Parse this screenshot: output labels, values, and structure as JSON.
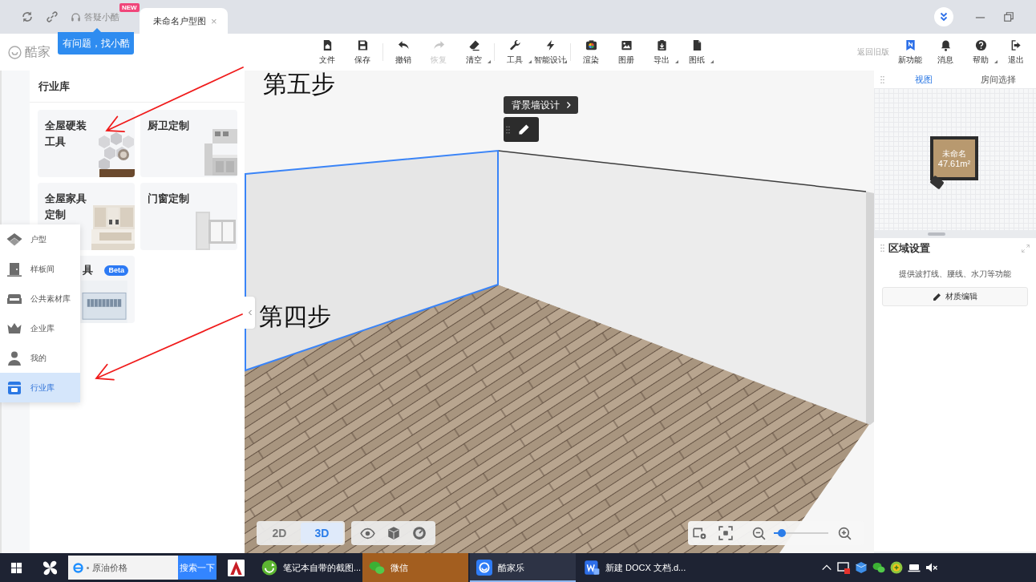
{
  "title_bar": {
    "help": {
      "label": "答疑小酷",
      "badge": "NEW"
    },
    "tabs": [
      {
        "label": "未命名户型图",
        "selected": true,
        "close": "×"
      }
    ],
    "tooltip": "有问题，找小酷"
  },
  "toolbar": {
    "logo": "酷家",
    "groups": [
      [
        {
          "label": "文件",
          "disabled": false,
          "menu": false
        },
        {
          "label": "保存",
          "disabled": false,
          "menu": false
        }
      ],
      [
        {
          "label": "撤销",
          "disabled": false,
          "menu": false
        },
        {
          "label": "恢复",
          "disabled": true,
          "menu": false
        },
        {
          "label": "清空",
          "disabled": false,
          "menu": true
        }
      ],
      [
        {
          "label": "工具",
          "disabled": false,
          "menu": true
        },
        {
          "label": "智能设计",
          "disabled": false,
          "menu": true
        }
      ],
      [
        {
          "label": "渲染",
          "disabled": false,
          "menu": false
        },
        {
          "label": "图册",
          "disabled": false,
          "menu": false
        },
        {
          "label": "导出",
          "disabled": false,
          "menu": true
        },
        {
          "label": "图纸",
          "disabled": false,
          "menu": true
        }
      ]
    ],
    "old_version": "返回旧版",
    "right_items": [
      {
        "label": "新功能",
        "disabled": false,
        "menu": false
      },
      {
        "label": "消息",
        "disabled": false,
        "menu": false
      },
      {
        "label": "帮助",
        "disabled": false,
        "menu": true
      },
      {
        "label": "退出",
        "disabled": false,
        "menu": false
      }
    ]
  },
  "library_panel": {
    "title": "行业库",
    "cards": [
      {
        "kind": "tile",
        "title": "全屋硬装工具"
      },
      {
        "kind": "tile",
        "title": "厨卫定制"
      },
      {
        "kind": "tile",
        "title": "全屋家具定制"
      },
      {
        "kind": "tile",
        "title": "门窗定制"
      },
      {
        "kind": "banner",
        "title": "具",
        "badge": "Beta"
      }
    ]
  },
  "nav_menu": {
    "items": [
      {
        "label": "户型",
        "selected": false
      },
      {
        "label": "样板间",
        "selected": false
      },
      {
        "label": "公共素材库",
        "selected": false
      },
      {
        "label": "企业库",
        "selected": false
      },
      {
        "label": "我的",
        "selected": false
      },
      {
        "label": "行业库",
        "selected": true
      }
    ]
  },
  "viewport": {
    "wall_label": "背景墙设计",
    "view_modes": [
      {
        "label": "2D",
        "selected": false
      },
      {
        "label": "3D",
        "selected": true
      }
    ],
    "zoom": {
      "level": 0.15
    }
  },
  "minimap": {
    "tabs": [
      {
        "label": "视图",
        "selected": true
      },
      {
        "label": "房间选择",
        "selected": false
      }
    ],
    "room": {
      "name": "未命名",
      "area": "47.61m²"
    }
  },
  "area_settings": {
    "title": "区域设置",
    "description": "提供波打线、腰线、水刀等功能",
    "button": "材质编辑"
  },
  "taskbar": {
    "search": {
      "placeholder": "原油价格"
    },
    "search_button": "搜索一下",
    "tasks": [
      {
        "label": "笔记本自带的截图...",
        "selected": false,
        "flashing": false
      },
      {
        "label": "微信",
        "selected": false,
        "flashing": true
      },
      {
        "label": "酷家乐",
        "selected": true,
        "flashing": false
      },
      {
        "label": "新建 DOCX 文档.d...",
        "selected": false,
        "flashing": false
      }
    ]
  },
  "annotations": [
    {
      "label": "第五步"
    },
    {
      "label": "第四步"
    }
  ]
}
